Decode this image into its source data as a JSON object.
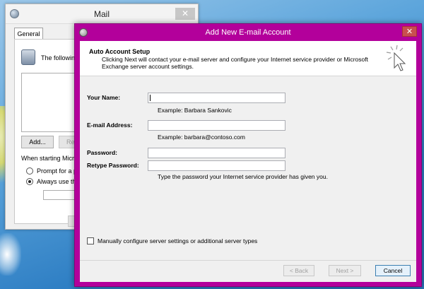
{
  "mail_window": {
    "title": "Mail",
    "close": "✕",
    "tab_general": "General",
    "intro_text": "The following",
    "add_button": "Add...",
    "remove_button_partial": "Re",
    "startup_label": "When starting Micros",
    "radio_prompt": "Prompt for a p",
    "radio_always": "Always use th"
  },
  "dialog": {
    "title": "Add New E-mail Account",
    "close": "✕",
    "heading": "Auto Account Setup",
    "description": "Clicking Next will contact your e-mail server and configure your Internet service provider or Microsoft Exchange server account settings.",
    "fields": {
      "name_label": "Your Name:",
      "name_value": "",
      "name_example": "Example: Barbara Sankovic",
      "email_label": "E-mail Address:",
      "email_value": "",
      "email_example": "Example: barbara@contoso.com",
      "password_label": "Password:",
      "retype_label": "Retype Password:",
      "password_hint": "Type the password your Internet service provider has given you."
    },
    "manual_config": "Manually configure server settings or additional server types",
    "buttons": {
      "back": "< Back",
      "next": "Next >",
      "cancel": "Cancel"
    }
  },
  "colors": {
    "dialog_frame": "#b3009b",
    "desktop": "#4d9ad4"
  }
}
